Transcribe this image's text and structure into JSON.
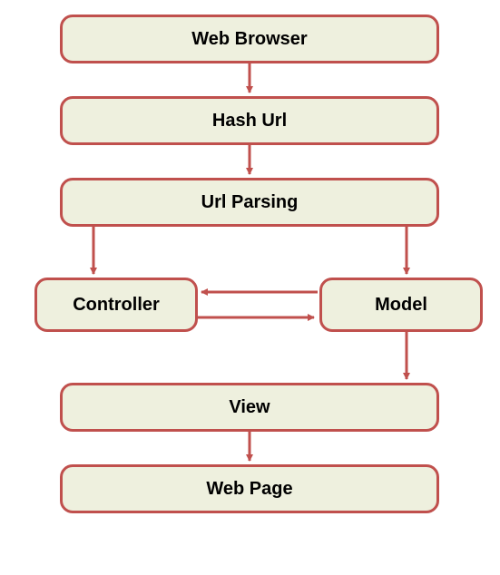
{
  "nodes": {
    "web_browser": "Web Browser",
    "hash_url": "Hash Url",
    "url_parsing": "Url Parsing",
    "controller": "Controller",
    "model": "Model",
    "view": "View",
    "web_page": "Web Page"
  },
  "flow": [
    {
      "from": "web_browser",
      "to": "hash_url"
    },
    {
      "from": "hash_url",
      "to": "url_parsing"
    },
    {
      "from": "url_parsing",
      "to": "controller"
    },
    {
      "from": "url_parsing",
      "to": "model"
    },
    {
      "from": "controller",
      "to": "model",
      "bidirectional": true
    },
    {
      "from": "model",
      "to": "view"
    },
    {
      "from": "view",
      "to": "web_page"
    }
  ],
  "colors": {
    "node_fill": "#eef0de",
    "node_border": "#c0504d",
    "arrow": "#c0504d"
  }
}
